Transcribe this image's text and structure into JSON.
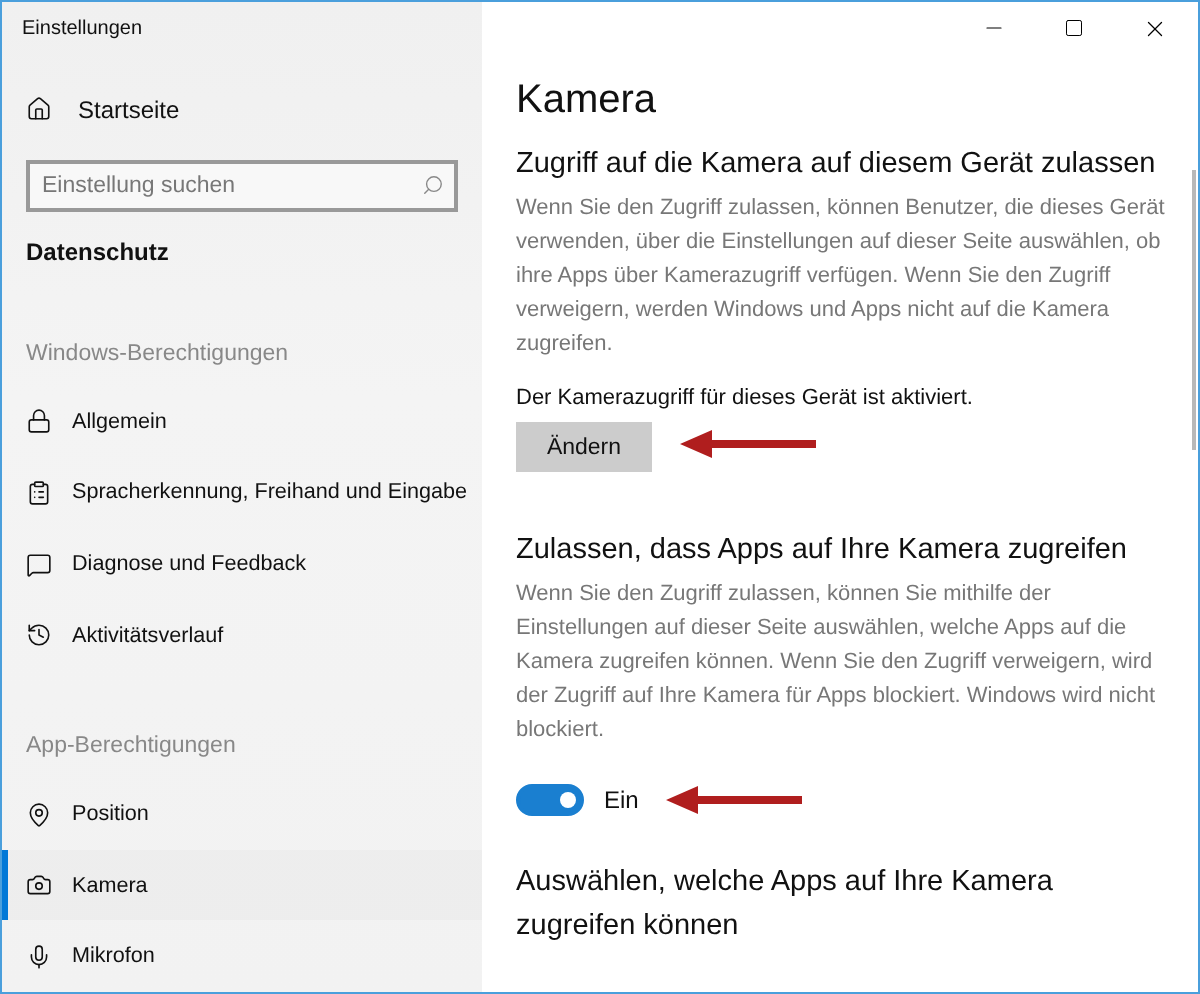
{
  "window": {
    "title": "Einstellungen"
  },
  "sidebar": {
    "home": {
      "label": "Startseite"
    },
    "search": {
      "placeholder": "Einstellung suchen"
    },
    "section_title": "Datenschutz",
    "groups": [
      {
        "heading": "Windows-Berechtigungen",
        "items": [
          {
            "label": "Allgemein",
            "selected": false
          },
          {
            "label": "Spracherkennung, Freihand und Eingabe",
            "selected": false
          },
          {
            "label": "Diagnose und Feedback",
            "selected": false
          },
          {
            "label": "Aktivitätsverlauf",
            "selected": false
          }
        ]
      },
      {
        "heading": "App-Berechtigungen",
        "items": [
          {
            "label": "Position",
            "selected": false
          },
          {
            "label": "Kamera",
            "selected": true
          },
          {
            "label": "Mikrofon",
            "selected": false
          }
        ]
      }
    ]
  },
  "content": {
    "title": "Kamera",
    "sections": [
      {
        "heading": "Zugriff auf die Kamera auf diesem Gerät zulassen",
        "description": "Wenn Sie den Zugriff zulassen, können Benutzer, die dieses Gerät verwenden, über die Einstellungen auf dieser Seite auswählen, ob ihre Apps über Kamerazugriff verfügen. Wenn Sie den Zugriff verweigern, werden Windows und Apps nicht auf die Kamera zugreifen.",
        "status": "Der Kamerazugriff für dieses Gerät ist aktiviert.",
        "button": "Ändern"
      },
      {
        "heading": "Zulassen, dass Apps auf Ihre Kamera zugreifen",
        "description": "Wenn Sie den Zugriff zulassen, können Sie mithilfe der Einstellungen auf dieser Seite auswählen, welche Apps auf die Kamera zugreifen können. Wenn Sie den Zugriff verweigern, wird der Zugriff auf Ihre Kamera für Apps blockiert. Windows wird nicht blockiert.",
        "toggle": {
          "on": true,
          "label": "Ein"
        }
      },
      {
        "heading": "Auswählen, welche Apps auf Ihre Kamera zugreifen können"
      }
    ]
  }
}
